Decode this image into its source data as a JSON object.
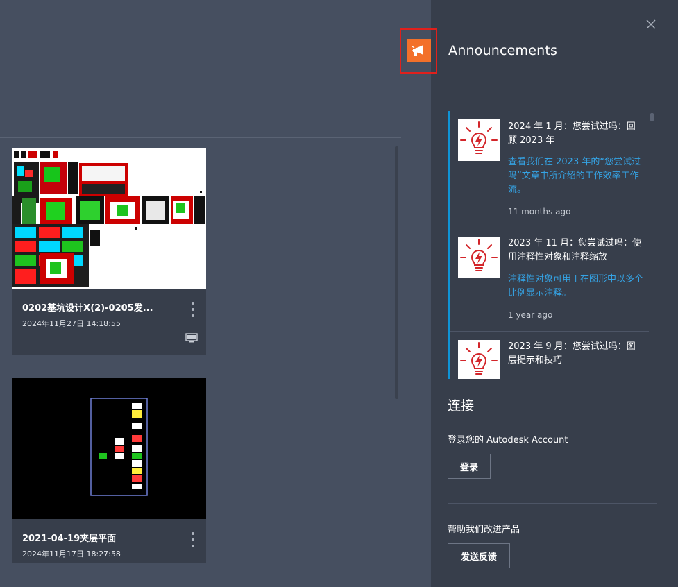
{
  "panel": {
    "title": "Announcements"
  },
  "announcements": [
    {
      "heading": "2024 年 1 月：您尝试过吗：回顾 2023 年",
      "body": "查看我们在 2023 年的“您尝试过吗”文章中所介绍的工作效率工作流。",
      "time": "11 months ago"
    },
    {
      "heading": "2023 年 11 月：您尝试过吗：使用注释性对象和注释缩放",
      "body": "注释性对象可用于在图形中以多个比例显示注释。",
      "time": "1 year ago"
    },
    {
      "heading": "2023 年 9 月：您尝试过吗：图层提示和技巧",
      "body": "",
      "time": ""
    }
  ],
  "connect": {
    "title": "连接",
    "signin_prompt": "登录您的 Autodesk Account",
    "signin_button": "登录"
  },
  "feedback": {
    "prompt": "帮助我们改进产品",
    "button": "发送反馈"
  },
  "files": [
    {
      "name": "0202基坑设计X(2)-0205发...",
      "date": "2024年11月27日 14:18:55"
    },
    {
      "name": "2021-04-19夹层平面",
      "date": "2024年11月17日 18:27:58"
    }
  ],
  "colors": {
    "accent": "#0f94d6",
    "announce_icon_bg": "#f3702a",
    "highlight_border": "#e0201c",
    "link": "#35a3e4"
  },
  "icons": {
    "close": "close-icon",
    "announce": "megaphone-icon",
    "lightbulb": "lightbulb-icon",
    "menu": "more-vertical-icon",
    "monitor": "monitor-icon"
  }
}
